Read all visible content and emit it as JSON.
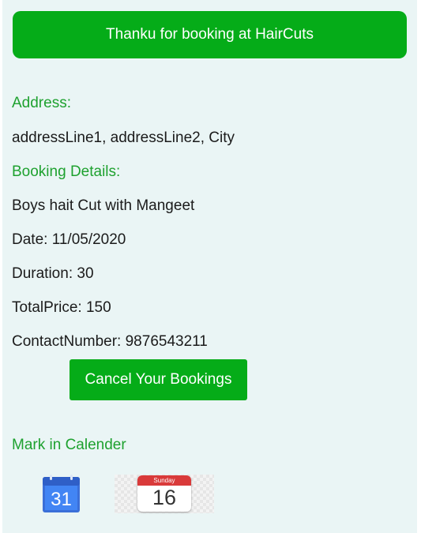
{
  "header": {
    "title": "Thanku for booking at HairCuts"
  },
  "address": {
    "label": "Address:",
    "value": "addressLine1, addressLine2, City"
  },
  "booking": {
    "label": "Booking Details:",
    "service": "Boys hait Cut with Mangeet",
    "date": "Date: 11/05/2020",
    "duration": "Duration: 30",
    "total_price": "TotalPrice: 150",
    "contact": "ContactNumber: 9876543211"
  },
  "actions": {
    "cancel_label": "Cancel Your Bookings"
  },
  "calendar": {
    "label": "Mark in Calender",
    "google": {
      "icon": "google-calendar-icon",
      "day": "31"
    },
    "apple": {
      "icon": "apple-calendar-icon",
      "weekday": "Sunday",
      "day": "16"
    }
  },
  "colors": {
    "accent": "#05ac18",
    "label_green": "#1ea12f",
    "background": "#eaf5f5"
  }
}
